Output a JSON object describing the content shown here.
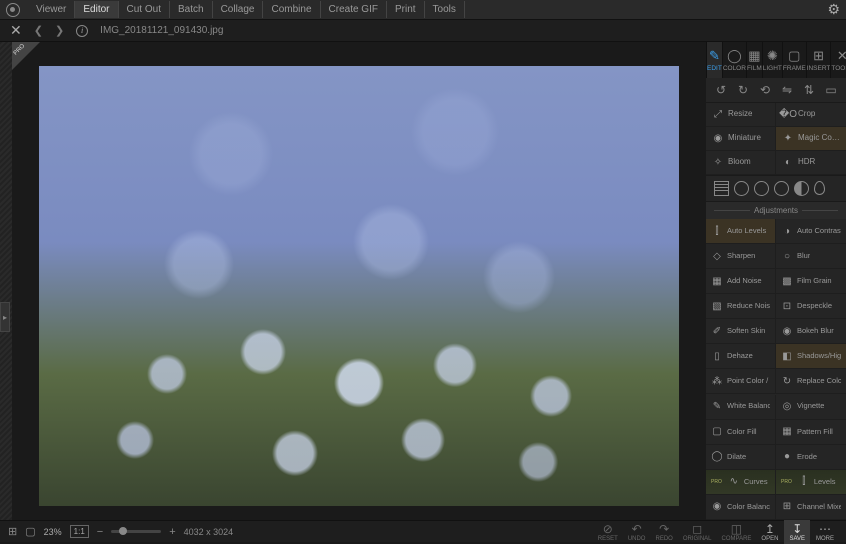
{
  "menu": {
    "items": [
      "Viewer",
      "Editor",
      "Cut Out",
      "Batch",
      "Collage",
      "Combine",
      "Create GIF",
      "Print",
      "Tools"
    ],
    "active": 1
  },
  "file": {
    "name": "IMG_20181121_091430.jpg"
  },
  "modes": [
    {
      "label": "EDIT",
      "icon": "✎"
    },
    {
      "label": "COLOR",
      "icon": "◯"
    },
    {
      "label": "FILM",
      "icon": "▦"
    },
    {
      "label": "LIGHT",
      "icon": "✺"
    },
    {
      "label": "FRAME",
      "icon": "▢"
    },
    {
      "label": "INSERT",
      "icon": "⊞"
    },
    {
      "label": "TOOLS",
      "icon": "✕"
    }
  ],
  "transform": [
    {
      "label": "Resize",
      "icon": "⤢"
    },
    {
      "label": "Crop",
      "icon": "�O"
    },
    {
      "label": "Miniature",
      "icon": "◉"
    },
    {
      "label": "Magic Color",
      "icon": "✦"
    },
    {
      "label": "Bloom",
      "icon": "✧"
    },
    {
      "label": "HDR",
      "icon": "◐"
    }
  ],
  "adjust_hdr": "Adjustments",
  "adjust": [
    {
      "label": "Auto Levels",
      "icon": "⫿",
      "sel": true
    },
    {
      "label": "Auto Contrast",
      "icon": "◑"
    },
    {
      "label": "Sharpen",
      "icon": "◇"
    },
    {
      "label": "Blur",
      "icon": "○"
    },
    {
      "label": "Add Noise",
      "icon": "▦"
    },
    {
      "label": "Film Grain",
      "icon": "▩"
    },
    {
      "label": "Reduce Noise",
      "icon": "▧"
    },
    {
      "label": "Despeckle",
      "icon": "⊡"
    },
    {
      "label": "Soften Skin",
      "icon": "✐"
    },
    {
      "label": "Bokeh Blur",
      "icon": "◉"
    },
    {
      "label": "Dehaze",
      "icon": "▯"
    },
    {
      "label": "Shadows/Highlights",
      "icon": "◧",
      "sel": true
    },
    {
      "label": "Point Color / Emphasize Col.",
      "icon": "⁂"
    },
    {
      "label": "Replace Color",
      "icon": "↻"
    },
    {
      "label": "White Balance",
      "icon": "✎"
    },
    {
      "label": "Vignette",
      "icon": "◎"
    },
    {
      "label": "Color Fill",
      "icon": "▢"
    },
    {
      "label": "Pattern Fill",
      "icon": "▦"
    },
    {
      "label": "Dilate",
      "icon": "◯"
    },
    {
      "label": "Erode",
      "icon": "●"
    },
    {
      "label": "Curves",
      "icon": "∿",
      "pro": true
    },
    {
      "label": "Levels",
      "icon": "⫿",
      "pro": true
    },
    {
      "label": "Color Balance",
      "icon": "◉"
    },
    {
      "label": "Channel Mixer",
      "icon": "⊞"
    }
  ],
  "status": {
    "zoom": "23%",
    "fit": "1:1",
    "dims": "4032 x 3024"
  },
  "actions": [
    {
      "label": "RESET",
      "icon": "⊘"
    },
    {
      "label": "UNDO",
      "icon": "↶"
    },
    {
      "label": "REDO",
      "icon": "↷"
    },
    {
      "label": "ORIGINAL",
      "icon": "◻"
    },
    {
      "label": "COMPARE",
      "icon": "◫"
    },
    {
      "label": "OPEN",
      "icon": "↥"
    },
    {
      "label": "SAVE",
      "icon": "↧"
    },
    {
      "label": "MORE",
      "icon": "⋯"
    }
  ],
  "pro": "PRO"
}
